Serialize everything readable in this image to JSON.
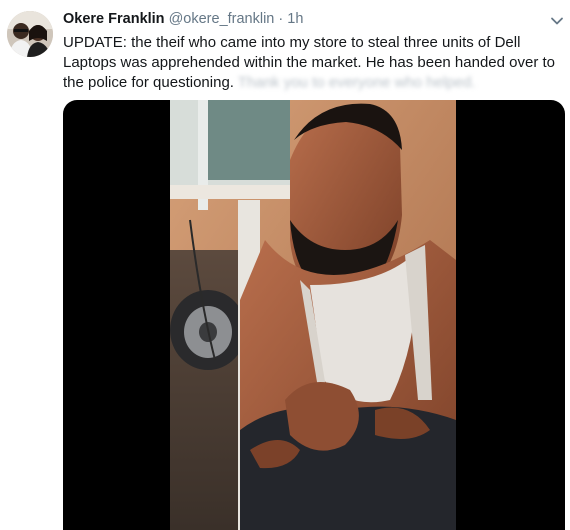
{
  "tweet": {
    "author_name": "Okere Franklin",
    "handle": "@okere_franklin",
    "separator": "·",
    "time": "1h",
    "text_visible": "UPDATE: the theif who came into my store to steal three units of Dell Laptops was apprehended within the market. He has been handed over to the police for questioning.",
    "text_obscured": "Thank you to everyone who helped."
  },
  "icons": {
    "avatar": "profile-photo",
    "menu": "chevron-down-icon"
  },
  "colors": {
    "text": "#14171a",
    "secondary": "#657786",
    "media_background": "#000000"
  }
}
